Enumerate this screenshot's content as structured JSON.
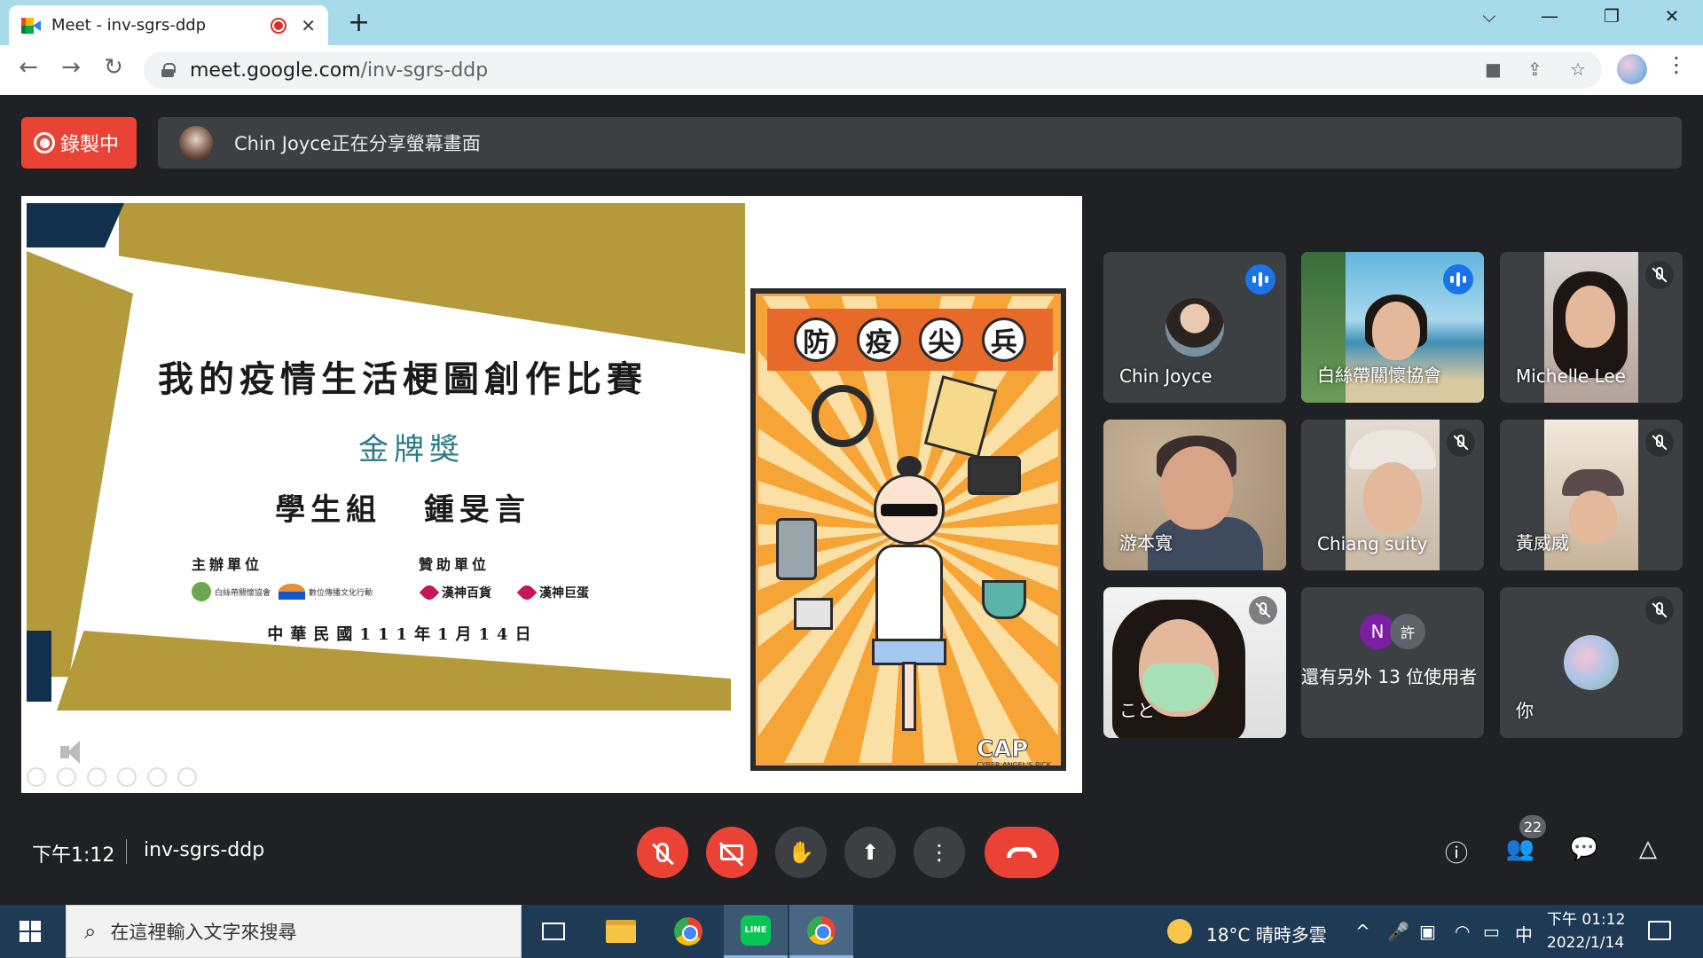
{
  "browser": {
    "tab_title": "Meet - inv-sgrs-ddp",
    "tab_close": "✕",
    "new_tab": "+",
    "url_host": "meet.google.com",
    "url_path": "/inv-sgrs-ddp",
    "icons": [
      "meet-logo-icon",
      "recording-dot-icon",
      "back-icon",
      "forward-icon",
      "reload-icon",
      "lock-icon",
      "camera-icon",
      "share-icon",
      "star-icon",
      "profile-avatar",
      "menu-icon"
    ]
  },
  "meet": {
    "recording_label": "錄製中",
    "share_banner": "Chin Joyce正在分享螢幕畫面",
    "meeting_time": "下午1:12",
    "meeting_code": "inv-sgrs-ddp",
    "people_count": "22",
    "more_users": "還有另外 13 位使用者",
    "more_badges": [
      {
        "letter": "N",
        "color": "#7b1fa2"
      },
      {
        "letter": "許",
        "color": "#5f6368"
      }
    ],
    "accent": "#8ab4f8",
    "danger": "#ea4335"
  },
  "slide": {
    "title": "我的疫情生活梗圖創作比賽",
    "award": "金牌獎",
    "group": "學生組 鍾旻言",
    "organizer_label": "主辦單位",
    "sponsor_label": "贊助單位",
    "organizer_logo_1": "白絲帶關懷協會",
    "organizer_logo_2": "數位傳播文化行動",
    "sponsor_1": "漢神百貨",
    "sponsor_2": "漢神巨蛋",
    "date": "中華民國111年1月14日",
    "poster_chars": [
      "防",
      "疫",
      "尖",
      "兵"
    ],
    "poster_logo": "CAP",
    "poster_logo_sub": "CYBER ANGEL'S PICK"
  },
  "participants": [
    {
      "name": "Chin Joyce",
      "state": "speaking-avatar"
    },
    {
      "name": "白絲帶關懷協會",
      "state": "speaking-video"
    },
    {
      "name": "Michelle Lee",
      "state": "muted"
    },
    {
      "name": "游本寬",
      "state": "video"
    },
    {
      "name": "Chiang suity",
      "state": "muted"
    },
    {
      "name": "黃威威",
      "state": "muted"
    },
    {
      "name": "こと",
      "state": "muted"
    },
    {
      "name": "你",
      "state": "muted-avatar"
    }
  ],
  "taskbar": {
    "search_placeholder": "在這裡輸入文字來搜尋",
    "weather": "18°C 晴時多雲",
    "ime": "中",
    "time": "下午 01:12",
    "date": "2022/1/14",
    "line_label": "LINE"
  }
}
